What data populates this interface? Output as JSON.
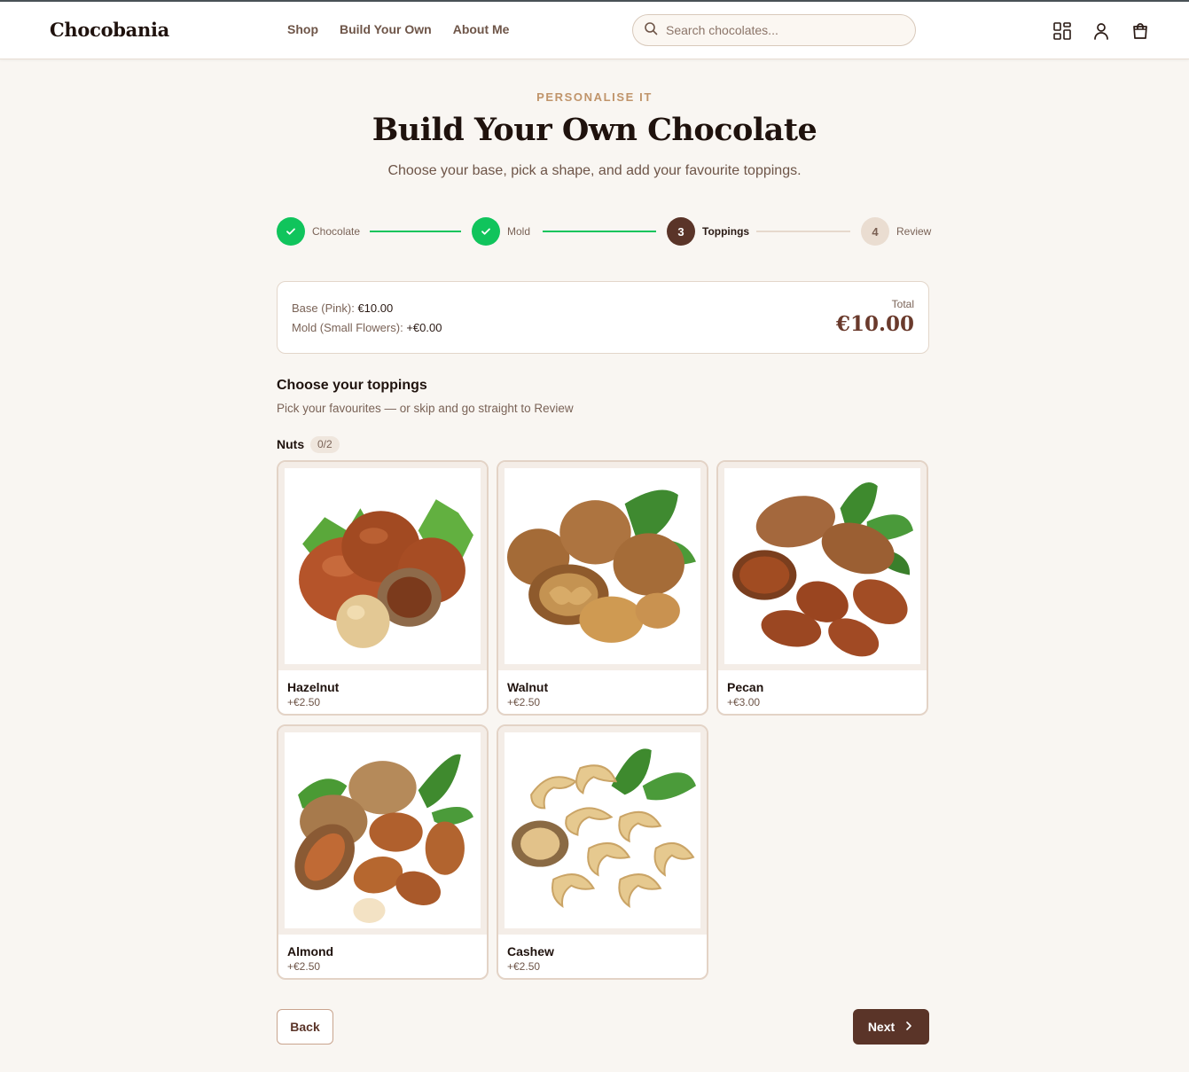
{
  "brand": "Chocobania",
  "nav": [
    "Shop",
    "Build Your Own",
    "About Me"
  ],
  "search": {
    "placeholder": "Search chocolates..."
  },
  "header_icons": [
    "grid-icon",
    "user-icon",
    "cart-icon"
  ],
  "hero": {
    "eyebrow": "PERSONALISE IT",
    "title": "Build Your Own Chocolate",
    "subtitle": "Choose your base, pick a shape, and add your favourite toppings."
  },
  "steps": [
    {
      "label": "Chocolate",
      "number": "1",
      "state": "done"
    },
    {
      "label": "Mold",
      "number": "2",
      "state": "done"
    },
    {
      "label": "Toppings",
      "number": "3",
      "state": "current"
    },
    {
      "label": "Review",
      "number": "4",
      "state": "todo"
    }
  ],
  "summary": {
    "base_label": "Base (Pink):",
    "base_value": "€10.00",
    "mold_label": "Mold (Small Flowers):",
    "mold_value": "+€0.00",
    "total_label": "Total",
    "total_value": "€10.00"
  },
  "toppings": {
    "title": "Choose your toppings",
    "subtitle": "Pick your favourites — or skip and go straight to Review",
    "category": "Nuts",
    "category_count": "0/2",
    "items": [
      {
        "name": "Hazelnut",
        "price": "+€2.50"
      },
      {
        "name": "Walnut",
        "price": "+€2.50"
      },
      {
        "name": "Pecan",
        "price": "+€3.00"
      },
      {
        "name": "Almond",
        "price": "+€2.50"
      },
      {
        "name": "Cashew",
        "price": "+€2.50"
      }
    ]
  },
  "actions": {
    "back": "Back",
    "next": "Next"
  },
  "colors": {
    "accent": "#5a3428",
    "success": "#10c45c",
    "eyebrow": "#c0946a",
    "background": "#f9f6f2"
  }
}
